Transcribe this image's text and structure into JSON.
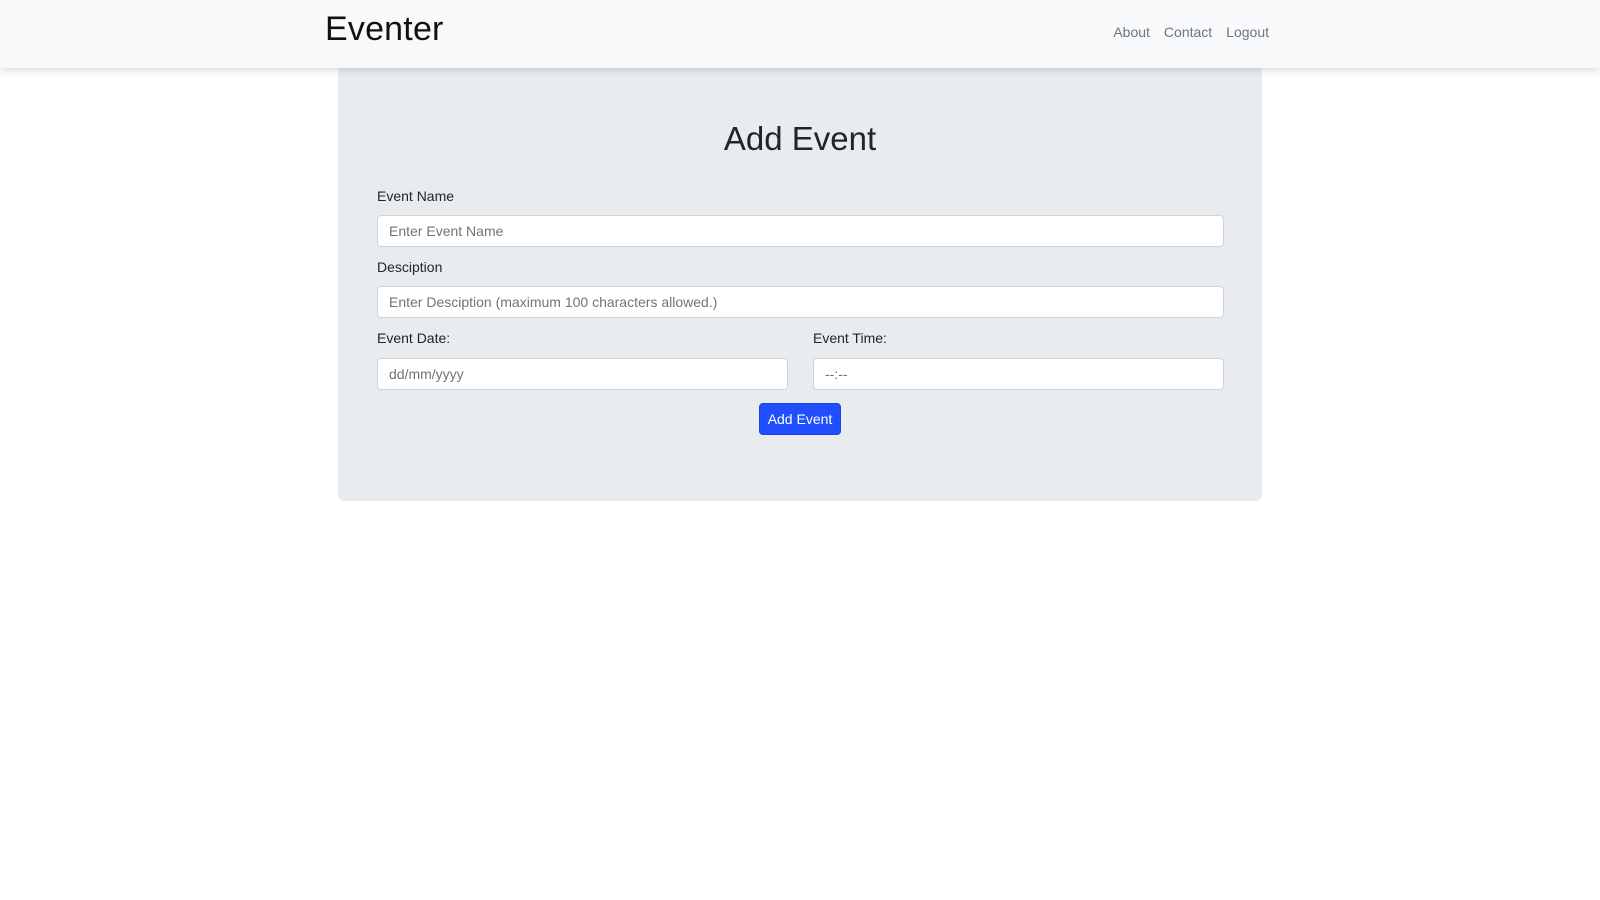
{
  "navbar": {
    "brand": "Eventer",
    "links": [
      {
        "label": "About"
      },
      {
        "label": "Contact"
      },
      {
        "label": "Logout"
      }
    ]
  },
  "form": {
    "title": "Add Event",
    "event_name": {
      "label": "Event Name",
      "placeholder": "Enter Event Name",
      "value": ""
    },
    "description": {
      "label": "Desciption",
      "placeholder": "Enter Desciption (maximum 100 characters allowed.)",
      "value": ""
    },
    "event_date": {
      "label": "Event Date:",
      "placeholder": "dd/mm/yyyy",
      "value": ""
    },
    "event_time": {
      "label": "Event Time:",
      "placeholder": "--:--",
      "value": ""
    },
    "submit_label": "Add Event"
  },
  "colors": {
    "navbar_bg": "#f8f9fa",
    "card_bg": "#e9ecef",
    "primary": "#1f4fff",
    "nav_link": "#6c757d"
  }
}
